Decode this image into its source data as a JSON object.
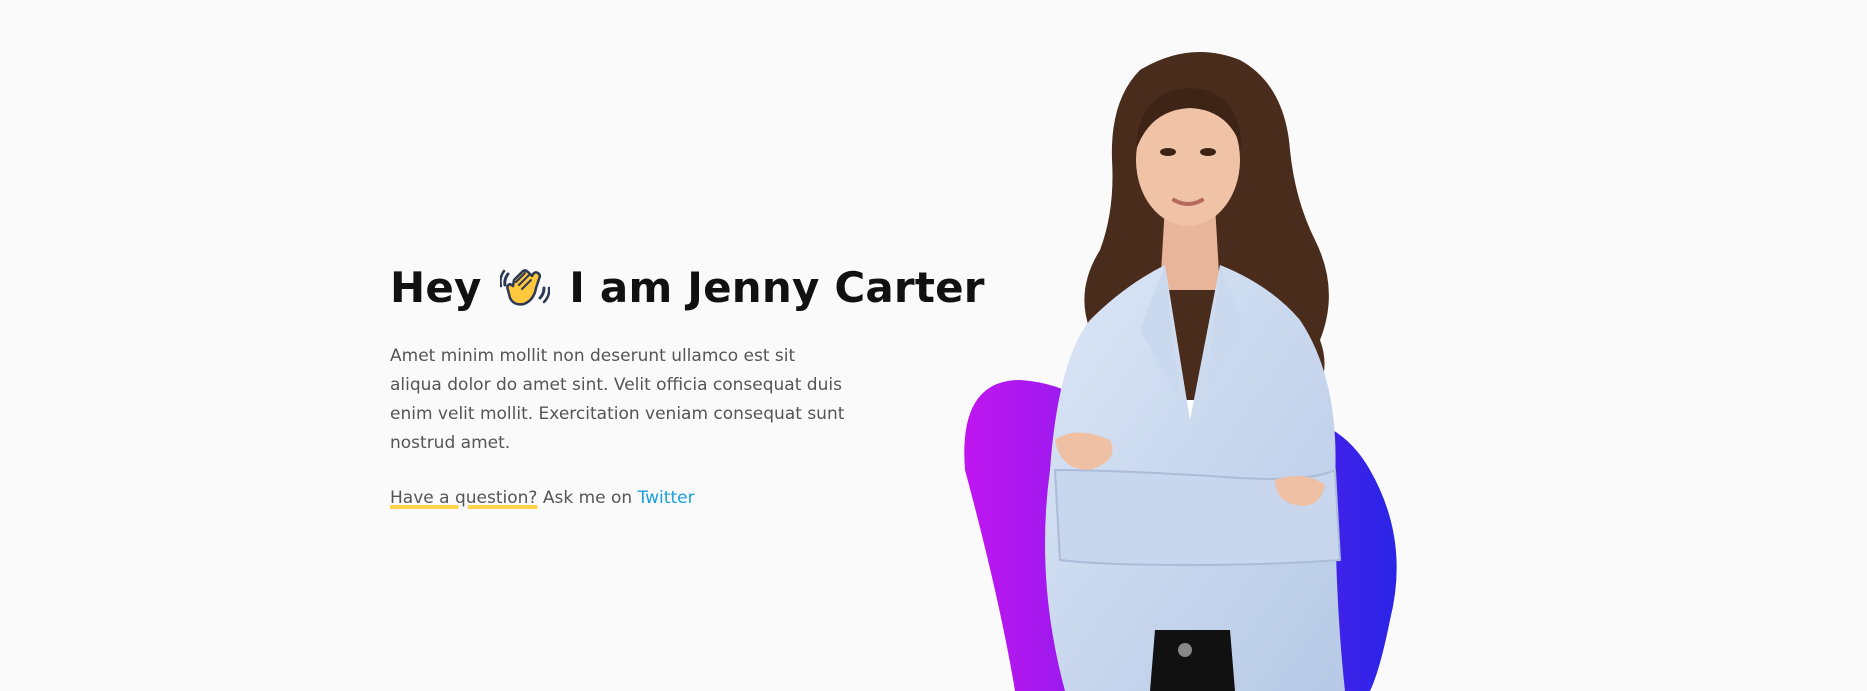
{
  "hero": {
    "title_before": "Hey",
    "title_after": "I am Jenny Carter",
    "description": "Amet minim mollit non deserunt ullamco est sit aliqua dolor do amet sint. Velit officia consequat duis enim velit mollit. Exercitation veniam consequat sunt nostrud amet.",
    "question": "Have a question?",
    "contact_prefix": "Ask me on",
    "link_label": "Twitter"
  },
  "icons": {
    "wave": "waving-hand-icon"
  },
  "colors": {
    "background": "#fafafa",
    "title": "#111111",
    "body_text": "#555555",
    "link": "#1aa0d8",
    "highlight": "#ffd24a",
    "blob_start": "#c016f0",
    "blob_end": "#2a24e8"
  }
}
